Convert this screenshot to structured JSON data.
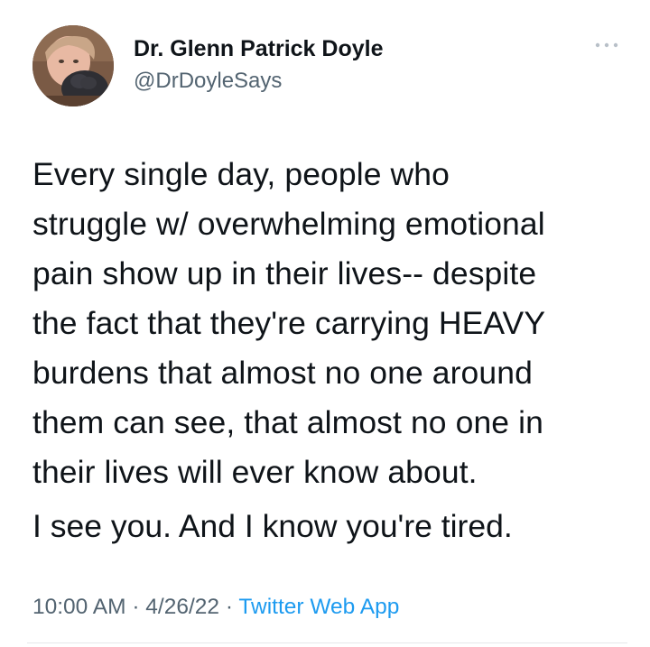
{
  "author": {
    "display_name": "Dr. Glenn Patrick Doyle",
    "handle": "@DrDoyleSays",
    "avatar_icon": "profile-photo"
  },
  "more_menu_icon": "ellipsis-icon",
  "tweet": {
    "lines": [
      "Every single day, people who",
      "struggle w/ overwhelming emotional",
      "pain show up in their lives-- despite",
      "the fact that they're carrying HEAVY",
      "burdens that almost no one around",
      "them can see, that almost no one in",
      "their lives will ever know about."
    ],
    "closing": "I see you. And I know you're tired."
  },
  "meta": {
    "time": "10:00 AM",
    "separator": "·",
    "date": "4/26/22",
    "source": "Twitter Web App"
  },
  "colors": {
    "text": "#0f1419",
    "secondary": "#536471",
    "link": "#1d9bf0"
  }
}
